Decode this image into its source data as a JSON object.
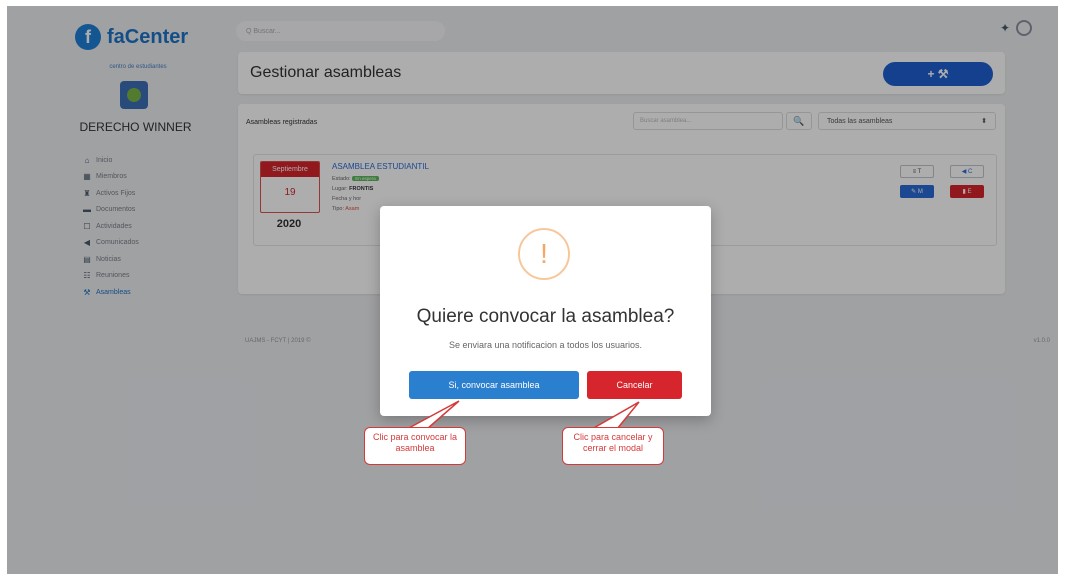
{
  "app": {
    "name": "faCenter",
    "logo_letter": "f"
  },
  "sidebar": {
    "org_caption": "centro de estudiantes",
    "org_name": "DERECHO WINNER",
    "items": [
      {
        "label": "Inicio",
        "icon": "home-icon",
        "glyph": "⌂"
      },
      {
        "label": "Miembros",
        "icon": "members-icon",
        "glyph": "▦"
      },
      {
        "label": "Activos Fijos",
        "icon": "assets-icon",
        "glyph": "♜"
      },
      {
        "label": "Documentos",
        "icon": "folder-icon",
        "glyph": "▬"
      },
      {
        "label": "Actividades",
        "icon": "activities-icon",
        "glyph": "☐"
      },
      {
        "label": "Comunicados",
        "icon": "megaphone-icon",
        "glyph": "◀"
      },
      {
        "label": "Noticias",
        "icon": "news-icon",
        "glyph": "▤"
      },
      {
        "label": "Reuniones",
        "icon": "meetings-icon",
        "glyph": "☷"
      },
      {
        "label": "Asambleas",
        "icon": "gavel-icon",
        "glyph": "⚒"
      }
    ]
  },
  "topbar": {
    "search_placeholder": "Q Buscar..."
  },
  "header": {
    "title": "Gestionar asambleas",
    "add_label": "+ ⚒"
  },
  "list": {
    "label": "Asambleas registradas",
    "search_placeholder": "Buscar asamblea...",
    "search_glyph": "🔍",
    "filter_value": "Todas las asambleas",
    "filter_arrow": "⬍"
  },
  "assembly": {
    "month": "Septiembre",
    "day": "19",
    "year": "2020",
    "title": "ASAMBLEA ESTUDIANTIL",
    "estado_label": "Estado:",
    "estado_value": "En espera",
    "lugar_label": "Lugar:",
    "lugar_value": "FRONTIS",
    "fecha_label": "Fecha y hor",
    "tipo_label": "Tipo:",
    "tipo_value": "Asam",
    "buttons": {
      "t": "≡ T",
      "c": "◀ C",
      "m": "✎ M",
      "e": "▮ E"
    }
  },
  "footer": {
    "left": "UAJMS - FCYT | 2019 ©",
    "right": "v1.0.0"
  },
  "modal": {
    "icon_glyph": "!",
    "title": "Quiere convocar la asamblea?",
    "text": "Se enviara una notificacion a todos los usuarios.",
    "confirm_label": "Si, convocar asamblea",
    "cancel_label": "Cancelar"
  },
  "callouts": {
    "confirm": "Clic para convocar la asamblea",
    "cancel": "Clic para cancelar y cerrar el modal"
  },
  "colors": {
    "primary": "#1e73c8",
    "danger": "#d6252d",
    "warning": "#f5a865",
    "success": "#5cb85c"
  }
}
